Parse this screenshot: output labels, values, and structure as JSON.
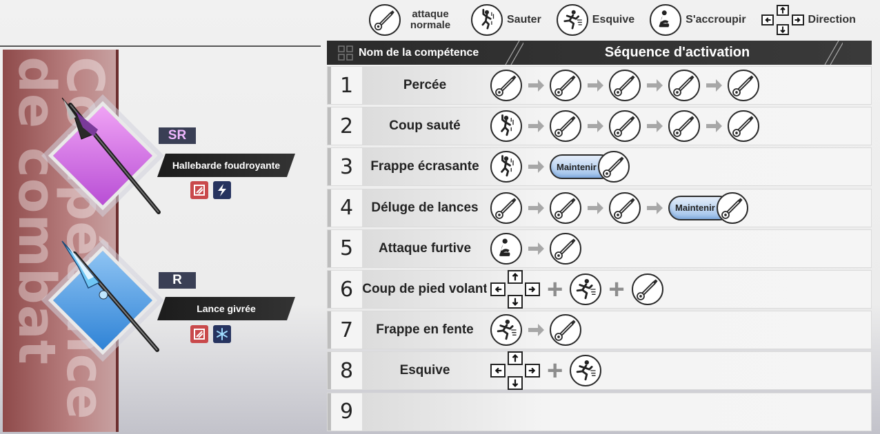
{
  "legend": {
    "attack": "attaque normale",
    "jump": "Sauter",
    "dodge": "Esquive",
    "crouch": "S'accroupir",
    "direction": "Direction"
  },
  "banner": {
    "title_line1": "Compétence",
    "title_line2": "de combat"
  },
  "weapons": [
    {
      "rarity": "SR",
      "name": "Hallebarde foudroyante",
      "accent": "#c768e0"
    },
    {
      "rarity": "R",
      "name": "Lance givrée",
      "accent": "#4a97e0"
    }
  ],
  "table": {
    "header_name": "Nom de la compétence",
    "header_sequence": "Séquence d'activation",
    "hold_label": "Maintenir",
    "rows": [
      {
        "num": "1",
        "name": "Percée"
      },
      {
        "num": "2",
        "name": "Coup sauté"
      },
      {
        "num": "3",
        "name": "Frappe écrasante"
      },
      {
        "num": "4",
        "name": "Déluge de lances"
      },
      {
        "num": "5",
        "name": "Attaque furtive"
      },
      {
        "num": "6",
        "name": "Coup de pied volant"
      },
      {
        "num": "7",
        "name": "Frappe en fente"
      },
      {
        "num": "8",
        "name": "Esquive"
      },
      {
        "num": "9",
        "name": ""
      }
    ]
  },
  "sequences": [
    [
      "attack",
      "arrow",
      "attack",
      "arrow",
      "attack",
      "arrow",
      "attack",
      "arrow",
      "attack"
    ],
    [
      "jump",
      "arrow",
      "attack",
      "arrow",
      "attack",
      "arrow",
      "attack",
      "arrow",
      "attack"
    ],
    [
      "jump",
      "arrow",
      "hold-attack"
    ],
    [
      "attack",
      "arrow",
      "attack",
      "arrow",
      "attack",
      "arrow",
      "hold-attack"
    ],
    [
      "crouch",
      "arrow",
      "attack"
    ],
    [
      "dpad",
      "plus",
      "dodge",
      "plus",
      "attack"
    ],
    [
      "dodge",
      "arrow",
      "attack"
    ],
    [
      "dpad",
      "plus",
      "dodge"
    ],
    []
  ],
  "colors": {
    "header_bg": "#2b2b2b",
    "banner": "#a86a6a",
    "hold_pill": "#9cc0ea"
  }
}
